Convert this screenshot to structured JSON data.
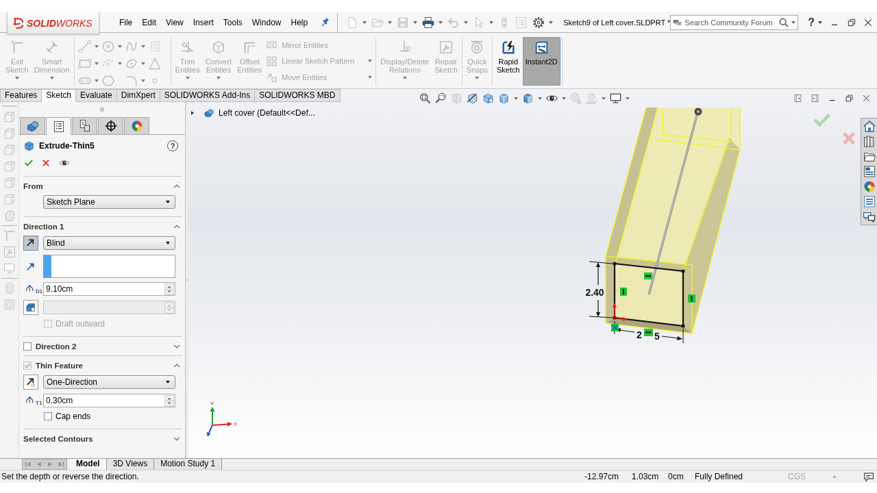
{
  "top_bar": {
    "logo": "**SOLID**WORKS",
    "menus": [
      "File",
      "Edit",
      "View",
      "Insert",
      "Tools",
      "Window",
      "Help"
    ],
    "document_title": "Sketch9 of Left cover.SLDPRT *",
    "search": {
      "placeholder": "Search Community Forum"
    },
    "help": "?"
  },
  "ribbon": {
    "groups": [
      [
        {
          "kind": "large",
          "label": "Exit Sketch",
          "disabled": true,
          "selected": false,
          "dropdown": true
        },
        {
          "kind": "large",
          "label": "Smart Dimension",
          "disabled": true,
          "selected": false,
          "dropdown": true
        }
      ],
      [
        {
          "kind": "tool_grid",
          "tools": [
            {
              "disabled": true,
              "dropdown": true
            },
            {
              "disabled": true,
              "dropdown": true
            },
            {
              "disabled": true,
              "dropdown": true
            },
            {
              "disabled": true,
              "dropdown": false
            },
            {
              "disabled": true,
              "dropdown": true
            },
            {
              "disabled": true,
              "dropdown": true
            },
            {
              "disabled": true,
              "dropdown": true
            },
            {
              "disabled": true,
              "dropdown": false
            },
            {
              "disabled": true,
              "dropdown": true
            },
            {
              "disabled": true,
              "dropdown": false
            },
            {
              "disabled": true,
              "dropdown": true
            },
            {
              "disabled": true,
              "dropdown": false
            }
          ]
        }
      ],
      [
        {
          "kind": "large",
          "label": "Trim Entities",
          "disabled": true,
          "selected": false,
          "dropdown": true
        },
        {
          "kind": "large",
          "label": "Convert Entities",
          "disabled": true,
          "selected": false,
          "dropdown": true
        },
        {
          "kind": "large",
          "label": "Offset Entities",
          "disabled": true,
          "selected": false,
          "dropdown": false
        },
        {
          "kind": "stack",
          "items": [
            {
              "label": "Mirror Entities",
              "disabled": true,
              "dropdown": false
            },
            {
              "label": "Linear Sketch Pattern",
              "disabled": true,
              "dropdown": true
            },
            {
              "label": "Move Entities",
              "disabled": true,
              "dropdown": true
            }
          ]
        }
      ],
      [
        {
          "kind": "large",
          "label": "Display/Delete Relations",
          "disabled": true,
          "selected": false,
          "dropdown": true
        },
        {
          "kind": "large",
          "label": "Repair Sketch",
          "disabled": true,
          "selected": false,
          "dropdown": false
        }
      ],
      [
        {
          "kind": "large",
          "label": "Quick Snaps",
          "disabled": true,
          "selected": false,
          "dropdown": true
        }
      ],
      [
        {
          "kind": "large",
          "label": "Rapid Sketch",
          "disabled": false,
          "selected": false,
          "dropdown": false
        },
        {
          "kind": "large",
          "label": "Instant2D",
          "disabled": false,
          "selected": true,
          "dropdown": false
        }
      ]
    ]
  },
  "command_tabs": [
    {
      "label": "Features",
      "selected": false
    },
    {
      "label": "Sketch",
      "selected": true
    },
    {
      "label": "Evaluate",
      "selected": false
    },
    {
      "label": "DimXpert",
      "selected": false
    },
    {
      "label": "SOLIDWORKS Add-Ins",
      "selected": false
    },
    {
      "label": "SOLIDWORKS MBD",
      "selected": false
    }
  ],
  "property_manager": {
    "tabs": [
      {
        "selected": false
      },
      {
        "selected": true
      },
      {
        "selected": false
      },
      {
        "selected": false
      },
      {
        "selected": false
      }
    ],
    "title": "Extrude-Thin5",
    "help": "?",
    "sections": [
      {
        "title": "From",
        "expanded": true,
        "rows": [
          {
            "kind": "dropdown",
            "value": "Sketch Plane"
          }
        ]
      },
      {
        "title": "Direction 1",
        "expanded": true,
        "rows": [
          {
            "kind": "dropdown",
            "value": "Blind",
            "reverse": {
              "selected": true
            }
          },
          {
            "kind": "selection_box",
            "active": true
          },
          {
            "kind": "spin",
            "symbol": "D1",
            "value": "9.10cm",
            "disabled": false
          },
          {
            "kind": "spin",
            "disabled": true
          },
          {
            "kind": "checkbox",
            "label": "Draft outward",
            "checked": false,
            "disabled": true
          }
        ]
      },
      {
        "title": "Direction 2",
        "expanded": false,
        "checkbox": {
          "checked": false,
          "disabled": false
        }
      },
      {
        "title": "Thin Feature",
        "expanded": true,
        "checkbox": {
          "checked": true,
          "disabled": true
        },
        "rows": [
          {
            "kind": "dropdown",
            "value": "One-Direction",
            "reverse": {
              "selected": false
            }
          },
          {
            "kind": "spin",
            "symbol": "T1",
            "value": "0.30cm",
            "disabled": false
          },
          {
            "kind": "checkbox",
            "label": "Cap ends",
            "checked": false,
            "disabled": false
          }
        ]
      },
      {
        "title": "Selected Contours",
        "expanded": false
      }
    ]
  },
  "graphics": {
    "tree_item": "Left cover (Default<<Def...",
    "height_dimension": "2.40",
    "width_dimension": [
      "2",
      "5"
    ],
    "triad": {
      "x": "X",
      "y": "Y"
    }
  },
  "document_tabs": [
    {
      "label": "Model",
      "selected": true
    },
    {
      "label": "3D Views",
      "selected": false
    },
    {
      "label": "Motion Study 1",
      "selected": false
    }
  ],
  "status_bar": {
    "message": "Set the depth or reverse the direction.",
    "coordinates": [
      "-12.97cm",
      "1.03cm",
      "0cm"
    ],
    "sketch_state": "Fully Defined",
    "units": "CGS"
  }
}
